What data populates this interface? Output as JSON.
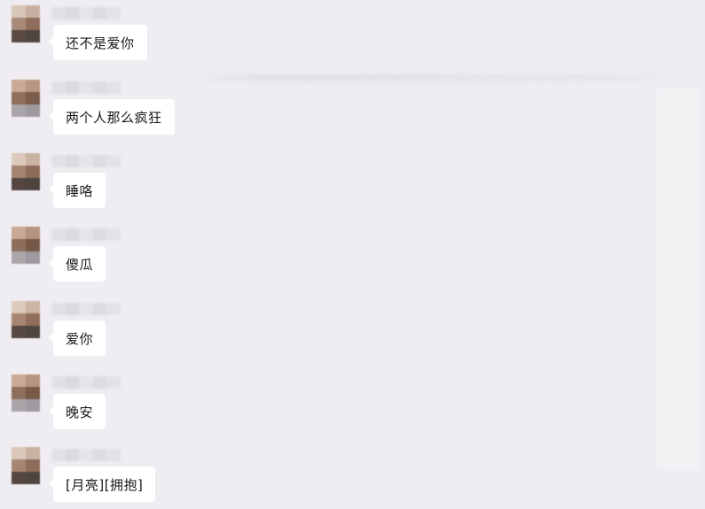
{
  "messages": [
    {
      "text": "还不是爱你",
      "avatar": [
        "#d8c6ba",
        "#c7b0a2",
        "#a98a78",
        "#8f6d5b",
        "#5a4a42",
        "#4e4540"
      ]
    },
    {
      "text": "两个人那么疯狂",
      "avatar": [
        "#c9ab97",
        "#b79682",
        "#8f6f5c",
        "#7a5c4b",
        "#a8a4a8",
        "#9d999f"
      ]
    },
    {
      "text": "睡咯",
      "avatar": [
        "#dcc9bc",
        "#cbb3a3",
        "#a48471",
        "#8d6b59",
        "#544540",
        "#4d4440"
      ]
    },
    {
      "text": "傻瓜",
      "avatar": [
        "#c8a995",
        "#b49380",
        "#8d6d5b",
        "#775947",
        "#aaa6aa",
        "#9e9aa0"
      ]
    },
    {
      "text": "爱你",
      "avatar": [
        "#dccabd",
        "#cbb4a4",
        "#a78773",
        "#8f6e5b",
        "#584842",
        "#4f4641"
      ]
    },
    {
      "text": "晚安",
      "avatar": [
        "#c9aa96",
        "#b59481",
        "#8e6e5c",
        "#785a48",
        "#a9a5a9",
        "#9f9ba1"
      ]
    },
    {
      "text": "[月亮][拥抱]",
      "avatar": [
        "#dbc8bb",
        "#cab2a2",
        "#a68672",
        "#8e6d5a",
        "#564641",
        "#4e4540"
      ]
    }
  ],
  "theme": {
    "background": "#efedf1",
    "bubble": "#ffffff",
    "text": "#1a1a1a"
  },
  "nickname_blur": [
    "#e2e0e5",
    "#dcdadf",
    "#e6e4e9",
    "#dedce1",
    "#e4e2e7"
  ]
}
